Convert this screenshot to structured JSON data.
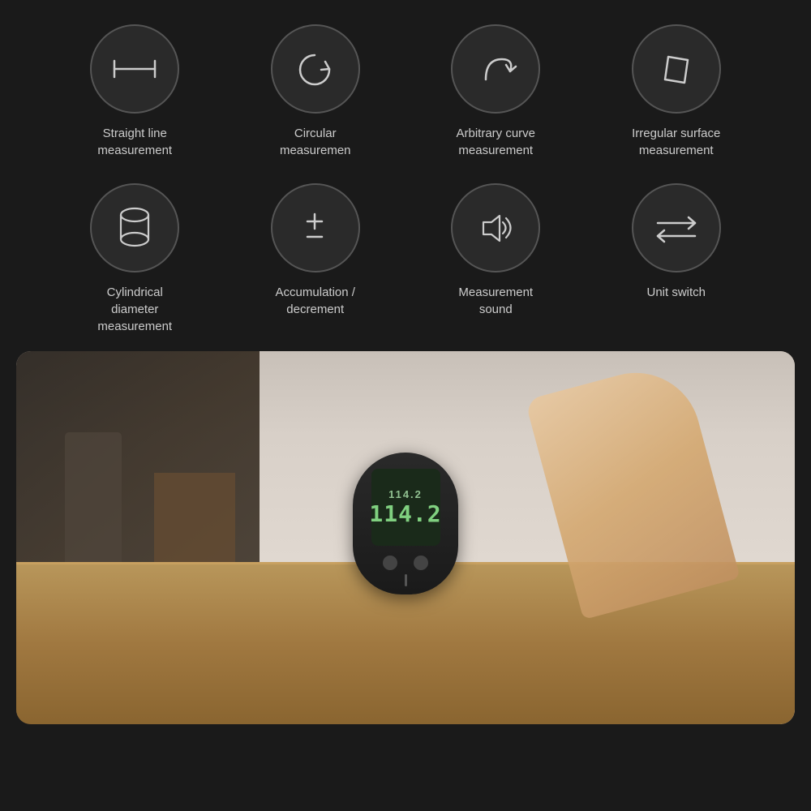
{
  "background": "#1a1a1a",
  "icons": [
    {
      "id": "straight-line",
      "label": "Straight line\nmeasurement",
      "icon_type": "straight-line"
    },
    {
      "id": "circular",
      "label": "Circular\nmeasuremen",
      "icon_type": "circular"
    },
    {
      "id": "arbitrary-curve",
      "label": "Arbitrary curve\nmeasurement",
      "icon_type": "arbitrary-curve"
    },
    {
      "id": "irregular-surface",
      "label": "Irregular surface\nmeasurement",
      "icon_type": "irregular-surface"
    },
    {
      "id": "cylindrical",
      "label": "Cylindrical\ndiameter\nmeasurement",
      "icon_type": "cylindrical"
    },
    {
      "id": "accumulation",
      "label": "Accumulation /\ndecrement",
      "icon_type": "accumulation"
    },
    {
      "id": "sound",
      "label": "Measurement\nsound",
      "icon_type": "sound"
    },
    {
      "id": "unit-switch",
      "label": "Unit switch",
      "icon_type": "unit-switch"
    }
  ],
  "device": {
    "reading_small": "114.2",
    "reading_large": "114.2"
  }
}
